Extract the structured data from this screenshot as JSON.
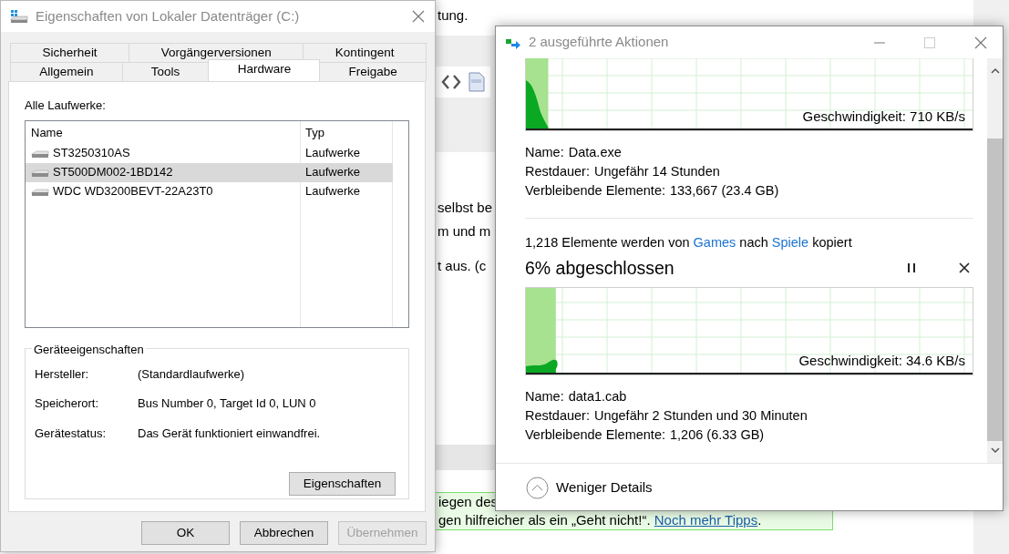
{
  "background_page": {
    "top_lines": [
      "tung."
    ],
    "body_lines": [
      "selbst be",
      "m und m",
      "t aus. (c"
    ],
    "tip": {
      "first_line": "iegen des",
      "last_line": "gen hilfreicher als ein „Geht nicht!“. ",
      "link": "Noch mehr Tipps",
      "suffix": "."
    }
  },
  "properties_dialog": {
    "title": "Eigenschaften von Lokaler Datenträger (C:)",
    "tab_rows": [
      [
        {
          "label": "Sicherheit",
          "selected": false
        },
        {
          "label": "Vorgängerversionen",
          "selected": false
        },
        {
          "label": "Kontingent",
          "selected": false
        }
      ],
      [
        {
          "label": "Allgemein",
          "selected": false
        },
        {
          "label": "Tools",
          "selected": false
        },
        {
          "label": "Hardware",
          "selected": true
        },
        {
          "label": "Freigabe",
          "selected": false
        }
      ]
    ],
    "drives_label": "Alle Laufwerke:",
    "columns": [
      "Name",
      "Typ"
    ],
    "drives": [
      {
        "name": "ST3250310AS",
        "type": "Laufwerke",
        "selected": false
      },
      {
        "name": "ST500DM002-1BD142",
        "type": "Laufwerke",
        "selected": true
      },
      {
        "name": "WDC WD3200BEVT-22A23T0",
        "type": "Laufwerke",
        "selected": false
      }
    ],
    "group_title": "Geräteeigenschaften",
    "properties": [
      {
        "label": "Hersteller:",
        "value": "(Standardlaufwerke)"
      },
      {
        "label": "Speicherort:",
        "value": "Bus Number 0, Target Id 0, LUN 0"
      },
      {
        "label": "Gerätestatus:",
        "value": "Das Gerät funktioniert einwandfrei."
      }
    ],
    "properties_button": "Eigenschaften",
    "buttons": [
      {
        "label": "OK",
        "disabled": false
      },
      {
        "label": "Abbrechen",
        "disabled": false
      },
      {
        "label": "Übernehmen",
        "disabled": true
      }
    ]
  },
  "copy_dialog": {
    "title": "2 ausgeführte Aktionen",
    "operations": [
      {
        "level": 0.05,
        "speed": "Geschwindigkeit: 710 KB/s",
        "details": [
          {
            "label": "Name:",
            "value": "Data.exe"
          },
          {
            "label": "Restdauer:",
            "value": "Ungefähr 14 Stunden"
          },
          {
            "label": "Verbleibende Elemente:",
            "value": "133,667 (23.4 GB)"
          }
        ]
      },
      {
        "summary": {
          "prefix": "1,218 Elemente werden von ",
          "source": "Games",
          "middle": " nach ",
          "target": "Spiele",
          "suffix": " kopiert"
        },
        "progress_title": "6% abgeschlossen",
        "level": 0.067,
        "speed": "Geschwindigkeit: 34.6 KB/s",
        "details": [
          {
            "label": "Name:",
            "value": "data1.cab"
          },
          {
            "label": "Restdauer:",
            "value": "Ungefähr 2 Stunden und 30 Minuten"
          },
          {
            "label": "Verbleibende Elemente:",
            "value": "1,206 (6.33 GB)"
          }
        ]
      }
    ],
    "details_toggle": "Weniger Details"
  }
}
